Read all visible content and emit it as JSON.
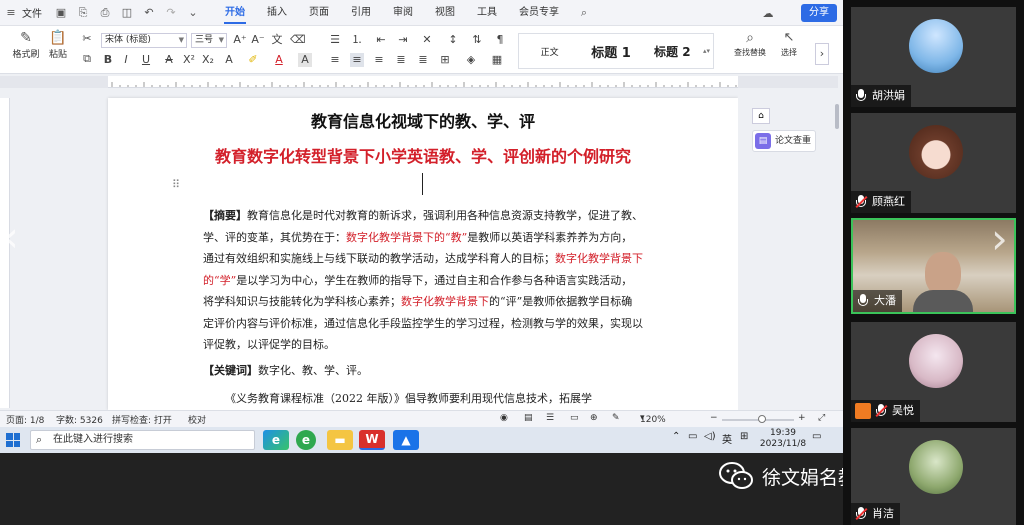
{
  "menubar": {
    "file": "文件",
    "tabs": [
      "开始",
      "插入",
      "页面",
      "引用",
      "审阅",
      "视图",
      "工具",
      "会员专享"
    ],
    "active_tab": "开始",
    "share": "分享"
  },
  "ribbon": {
    "format_painter": "格式刷",
    "paste": "粘贴",
    "font_name": "宋体 (标题)",
    "font_size": "三号",
    "styles": [
      "正文",
      "标题 1",
      "标题 2"
    ],
    "find_replace": "查找替换",
    "select": "选择"
  },
  "document": {
    "title": "教育信息化视域下的教、学、评",
    "subtitle": "教育数字化转型背景下小学英语教、学、评创新的个例研究",
    "abstract_label": "【摘要】",
    "abstract_parts": [
      {
        "text": "教育信息化是时代对教育的新诉求，强调利用各种信息资源支持教学，促进了教、学、评的变革，其优势在于：",
        "red": false
      },
      {
        "text": "数字化教学背景下的“教”",
        "red": true
      },
      {
        "text": "是教师以英语学科素养养为方向，通过有效组织和实施线上与线下联动的教学活动，达成学科育人的目标；",
        "red": false
      },
      {
        "text": "数字化教学背景下的“学”",
        "red": true
      },
      {
        "text": "是以学习为中心，学生在教师的指导下，通过自主和合作参与各种语言实践活动，将学科知识与技能转化为学科核心素养；",
        "red": false
      },
      {
        "text": "数字化教学背景下",
        "red": true
      },
      {
        "text": "的“评”是教师依据教学目标确定评价内容与评价标准，通过信息化手段监控学生的学习过程，检测教与学的效果，实现以评促教，以评促学的目标。",
        "red": false
      }
    ],
    "keywords_label": "【关键词】",
    "keywords": "数字化、教、学、评。",
    "body_start": "《义务教育课程标准（2022 年版）》倡导教师要利用现代信息技术，拓展学"
  },
  "sidebar": {
    "paper_check": "论文查重"
  },
  "statusbar": {
    "page": "页面: 1/8",
    "words": "字数: 5326",
    "spellcheck": "拼写检查: 打开",
    "proof": "校对",
    "zoom": "120%"
  },
  "taskbar": {
    "search_placeholder": "在此键入进行搜索",
    "ime": "英",
    "time": "19:39",
    "date": "2023/11/8"
  },
  "participants": [
    {
      "name": "胡洪娟",
      "muted": false
    },
    {
      "name": "顾燕红",
      "muted": true
    },
    {
      "name": "大潘",
      "muted": false
    },
    {
      "name": "吴悦",
      "muted": true
    },
    {
      "name": "肖洁",
      "muted": true
    }
  ],
  "watermark": "徐文娟名教师成长营"
}
